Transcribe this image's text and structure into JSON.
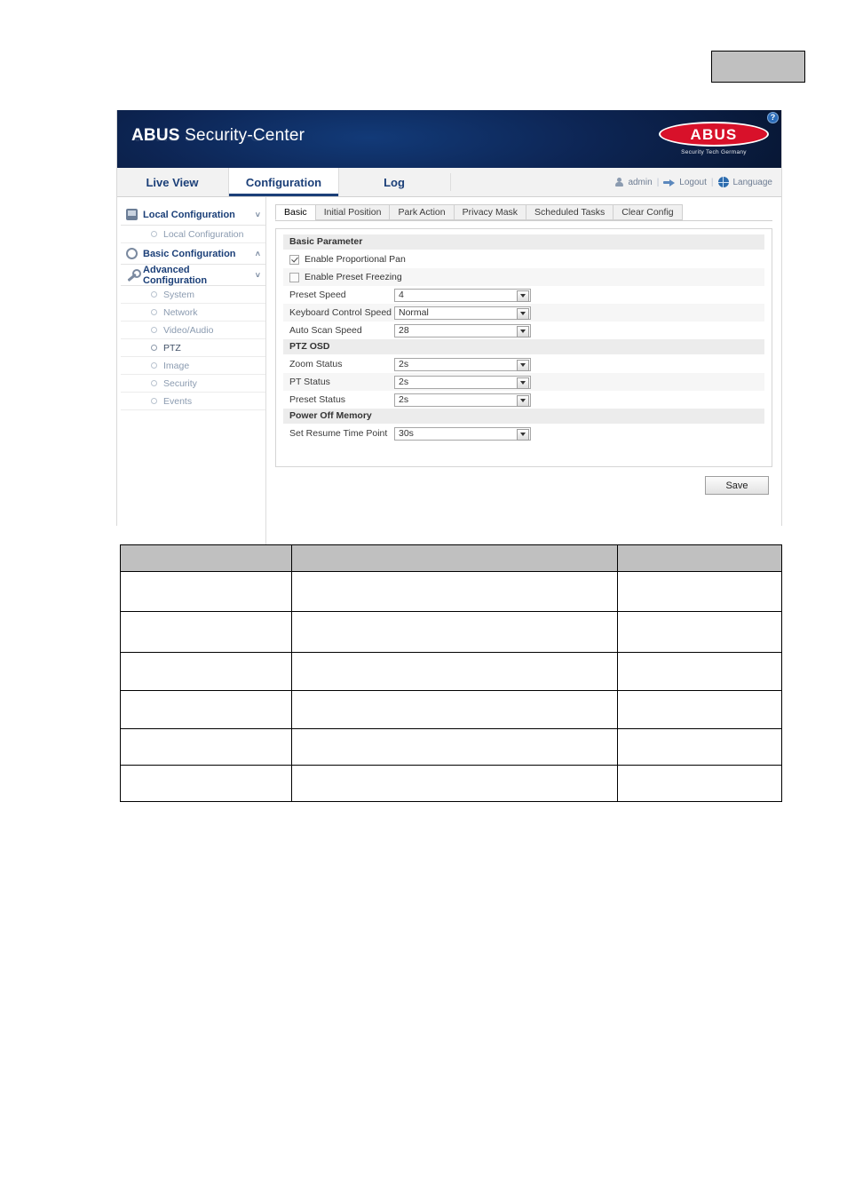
{
  "page": {
    "top_placeholder": ""
  },
  "banner": {
    "title_bold": "ABUS",
    "title_rest": " Security-Center",
    "logo_word": "ABUS",
    "logo_tagline": "Security Tech Germany",
    "help_icon_glyph": "?"
  },
  "navbar": {
    "tabs": [
      {
        "label": "Live View",
        "active": false
      },
      {
        "label": "Configuration",
        "active": true
      },
      {
        "label": "Log",
        "active": false
      }
    ],
    "user": "admin",
    "logout": "Logout",
    "language": "Language",
    "separator": "|"
  },
  "sidebar": {
    "groups": [
      {
        "label": "Local Configuration",
        "icon": "monitor-icon",
        "chevron": "˅",
        "items": [
          {
            "label": "Local Configuration",
            "selected": false
          }
        ]
      },
      {
        "label": "Basic Configuration",
        "icon": "gear-icon",
        "chevron": "˄",
        "items": []
      },
      {
        "label": "Advanced Configuration",
        "icon": "wrench-icon",
        "chevron": "˅",
        "items": [
          {
            "label": "System",
            "selected": false
          },
          {
            "label": "Network",
            "selected": false
          },
          {
            "label": "Video/Audio",
            "selected": false
          },
          {
            "label": "PTZ",
            "selected": true
          },
          {
            "label": "Image",
            "selected": false
          },
          {
            "label": "Security",
            "selected": false
          },
          {
            "label": "Events",
            "selected": false
          }
        ]
      }
    ]
  },
  "content": {
    "tabs": [
      {
        "label": "Basic",
        "active": true
      },
      {
        "label": "Initial Position",
        "active": false
      },
      {
        "label": "Park Action",
        "active": false
      },
      {
        "label": "Privacy Mask",
        "active": false
      },
      {
        "label": "Scheduled Tasks",
        "active": false
      },
      {
        "label": "Clear Config",
        "active": false
      }
    ],
    "sections": [
      {
        "heading": "Basic Parameter",
        "rows": [
          {
            "kind": "checkbox",
            "label": "Enable Proportional Pan",
            "checked": true
          },
          {
            "kind": "checkbox",
            "label": "Enable Preset Freezing",
            "checked": false
          },
          {
            "kind": "select",
            "label": "Preset Speed",
            "value": "4"
          },
          {
            "kind": "select",
            "label": "Keyboard Control Speed",
            "value": "Normal"
          },
          {
            "kind": "select",
            "label": "Auto Scan Speed",
            "value": "28"
          }
        ]
      },
      {
        "heading": "PTZ OSD",
        "rows": [
          {
            "kind": "select",
            "label": "Zoom Status",
            "value": "2s"
          },
          {
            "kind": "select",
            "label": "PT Status",
            "value": "2s"
          },
          {
            "kind": "select",
            "label": "Preset Status",
            "value": "2s"
          }
        ]
      },
      {
        "heading": "Power Off Memory",
        "rows": [
          {
            "kind": "select",
            "label": "Set Resume Time Point",
            "value": "30s"
          }
        ]
      }
    ],
    "save_label": "Save"
  },
  "doc_table": {
    "header": [
      "",
      "",
      ""
    ],
    "rows": [
      [
        "",
        "",
        ""
      ],
      [
        "",
        "",
        ""
      ],
      [
        "",
        "",
        ""
      ],
      [
        "",
        "",
        ""
      ],
      [
        "",
        "",
        ""
      ],
      [
        "",
        "",
        ""
      ]
    ]
  },
  "colors": {
    "banner_dark": "#0a1c3d",
    "brand_red": "#d8112a",
    "nav_blue": "#1b3f78",
    "table_header_gray": "#c0c0c0"
  }
}
